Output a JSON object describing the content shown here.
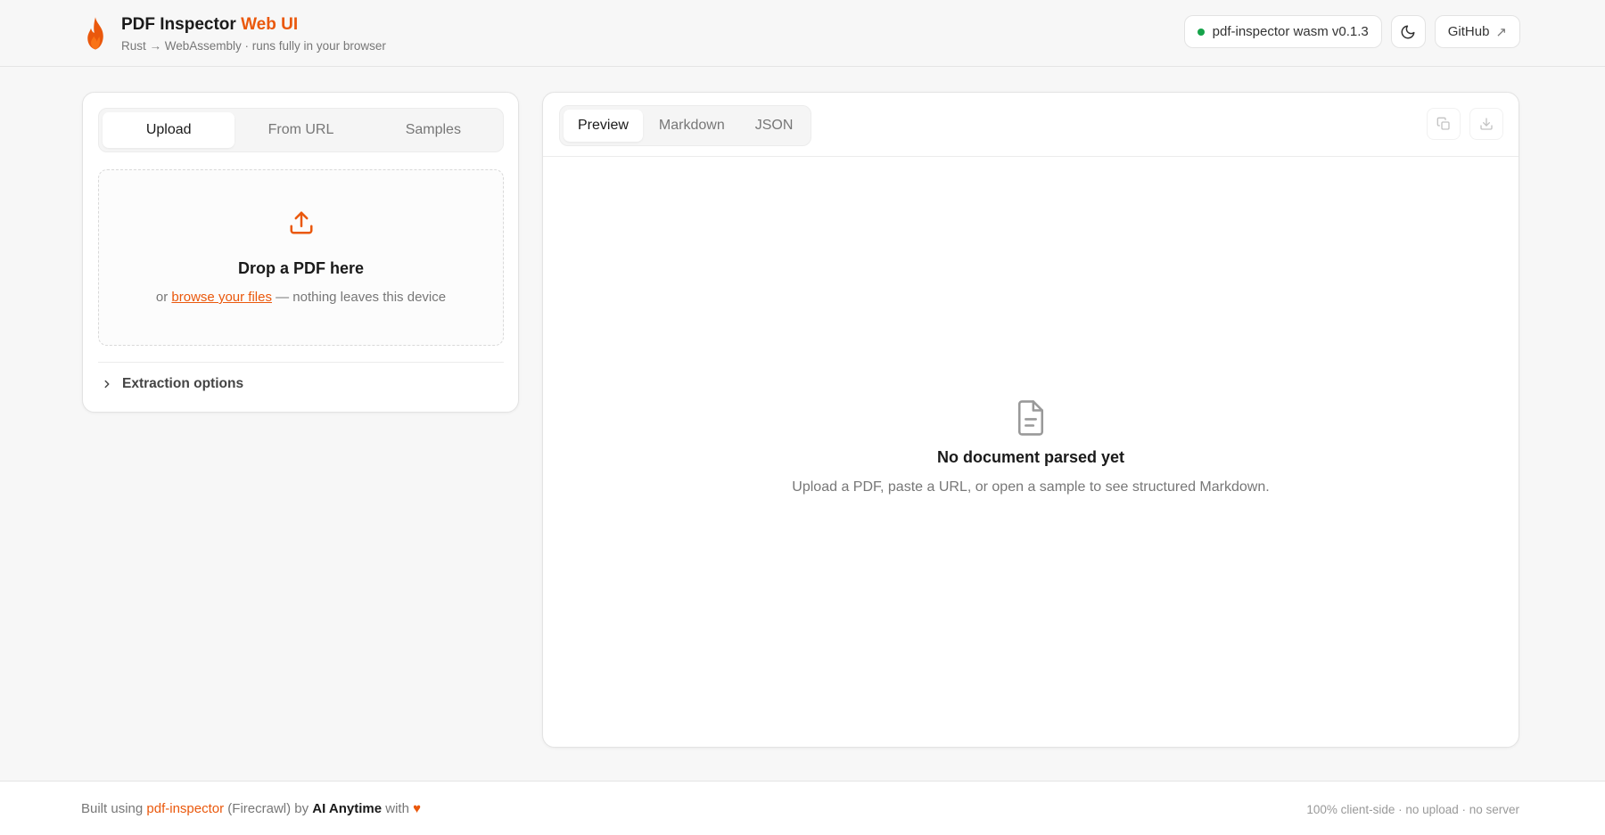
{
  "header": {
    "title_main": "PDF Inspector",
    "title_accent": "Web UI",
    "subtitle": "Rust → WebAssembly · runs fully in your browser",
    "version_badge": "pdf-inspector wasm v0.1.3",
    "github_label": "GitHub",
    "github_arrow": "↗"
  },
  "source_tabs": [
    {
      "label": "Upload",
      "active": true
    },
    {
      "label": "From URL",
      "active": false
    },
    {
      "label": "Samples",
      "active": false
    }
  ],
  "dropzone": {
    "title": "Drop a PDF here",
    "prefix": "or",
    "browse_link": "browse your files",
    "suffix": "— nothing leaves this device"
  },
  "extraction_options": {
    "label": "Extraction options"
  },
  "view_tabs": [
    {
      "label": "Preview",
      "active": true
    },
    {
      "label": "Markdown",
      "active": false
    },
    {
      "label": "JSON",
      "active": false
    }
  ],
  "empty_state": {
    "title": "No document parsed yet",
    "subtitle": "Upload a PDF, paste a URL, or open a sample to see structured Markdown."
  },
  "footer": {
    "built_using": "Built using",
    "lib_link": "pdf-inspector",
    "firecrawl": "(Firecrawl) by",
    "author": "AI Anytime",
    "with": "with",
    "heart": "♥",
    "right_text": "100% client-side · no upload · no server"
  },
  "colors": {
    "accent": "#ea580c",
    "status_ok": "#16a34a"
  },
  "icons": [
    "flame-icon",
    "moon-icon",
    "external-arrow-icon",
    "upload-icon",
    "chevron-right-icon",
    "copy-icon",
    "download-icon",
    "document-icon"
  ]
}
